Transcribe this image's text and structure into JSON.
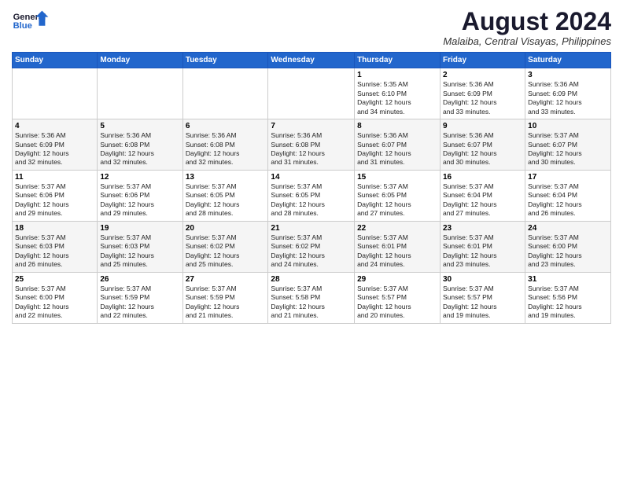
{
  "header": {
    "logo_general": "General",
    "logo_blue": "Blue",
    "month_year": "August 2024",
    "location": "Malaiba, Central Visayas, Philippines"
  },
  "weekdays": [
    "Sunday",
    "Monday",
    "Tuesday",
    "Wednesday",
    "Thursday",
    "Friday",
    "Saturday"
  ],
  "weeks": [
    [
      {
        "day": "",
        "info": ""
      },
      {
        "day": "",
        "info": ""
      },
      {
        "day": "",
        "info": ""
      },
      {
        "day": "",
        "info": ""
      },
      {
        "day": "1",
        "info": "Sunrise: 5:35 AM\nSunset: 6:10 PM\nDaylight: 12 hours\nand 34 minutes."
      },
      {
        "day": "2",
        "info": "Sunrise: 5:36 AM\nSunset: 6:09 PM\nDaylight: 12 hours\nand 33 minutes."
      },
      {
        "day": "3",
        "info": "Sunrise: 5:36 AM\nSunset: 6:09 PM\nDaylight: 12 hours\nand 33 minutes."
      }
    ],
    [
      {
        "day": "4",
        "info": "Sunrise: 5:36 AM\nSunset: 6:09 PM\nDaylight: 12 hours\nand 32 minutes."
      },
      {
        "day": "5",
        "info": "Sunrise: 5:36 AM\nSunset: 6:08 PM\nDaylight: 12 hours\nand 32 minutes."
      },
      {
        "day": "6",
        "info": "Sunrise: 5:36 AM\nSunset: 6:08 PM\nDaylight: 12 hours\nand 32 minutes."
      },
      {
        "day": "7",
        "info": "Sunrise: 5:36 AM\nSunset: 6:08 PM\nDaylight: 12 hours\nand 31 minutes."
      },
      {
        "day": "8",
        "info": "Sunrise: 5:36 AM\nSunset: 6:07 PM\nDaylight: 12 hours\nand 31 minutes."
      },
      {
        "day": "9",
        "info": "Sunrise: 5:36 AM\nSunset: 6:07 PM\nDaylight: 12 hours\nand 30 minutes."
      },
      {
        "day": "10",
        "info": "Sunrise: 5:37 AM\nSunset: 6:07 PM\nDaylight: 12 hours\nand 30 minutes."
      }
    ],
    [
      {
        "day": "11",
        "info": "Sunrise: 5:37 AM\nSunset: 6:06 PM\nDaylight: 12 hours\nand 29 minutes."
      },
      {
        "day": "12",
        "info": "Sunrise: 5:37 AM\nSunset: 6:06 PM\nDaylight: 12 hours\nand 29 minutes."
      },
      {
        "day": "13",
        "info": "Sunrise: 5:37 AM\nSunset: 6:05 PM\nDaylight: 12 hours\nand 28 minutes."
      },
      {
        "day": "14",
        "info": "Sunrise: 5:37 AM\nSunset: 6:05 PM\nDaylight: 12 hours\nand 28 minutes."
      },
      {
        "day": "15",
        "info": "Sunrise: 5:37 AM\nSunset: 6:05 PM\nDaylight: 12 hours\nand 27 minutes."
      },
      {
        "day": "16",
        "info": "Sunrise: 5:37 AM\nSunset: 6:04 PM\nDaylight: 12 hours\nand 27 minutes."
      },
      {
        "day": "17",
        "info": "Sunrise: 5:37 AM\nSunset: 6:04 PM\nDaylight: 12 hours\nand 26 minutes."
      }
    ],
    [
      {
        "day": "18",
        "info": "Sunrise: 5:37 AM\nSunset: 6:03 PM\nDaylight: 12 hours\nand 26 minutes."
      },
      {
        "day": "19",
        "info": "Sunrise: 5:37 AM\nSunset: 6:03 PM\nDaylight: 12 hours\nand 25 minutes."
      },
      {
        "day": "20",
        "info": "Sunrise: 5:37 AM\nSunset: 6:02 PM\nDaylight: 12 hours\nand 25 minutes."
      },
      {
        "day": "21",
        "info": "Sunrise: 5:37 AM\nSunset: 6:02 PM\nDaylight: 12 hours\nand 24 minutes."
      },
      {
        "day": "22",
        "info": "Sunrise: 5:37 AM\nSunset: 6:01 PM\nDaylight: 12 hours\nand 24 minutes."
      },
      {
        "day": "23",
        "info": "Sunrise: 5:37 AM\nSunset: 6:01 PM\nDaylight: 12 hours\nand 23 minutes."
      },
      {
        "day": "24",
        "info": "Sunrise: 5:37 AM\nSunset: 6:00 PM\nDaylight: 12 hours\nand 23 minutes."
      }
    ],
    [
      {
        "day": "25",
        "info": "Sunrise: 5:37 AM\nSunset: 6:00 PM\nDaylight: 12 hours\nand 22 minutes."
      },
      {
        "day": "26",
        "info": "Sunrise: 5:37 AM\nSunset: 5:59 PM\nDaylight: 12 hours\nand 22 minutes."
      },
      {
        "day": "27",
        "info": "Sunrise: 5:37 AM\nSunset: 5:59 PM\nDaylight: 12 hours\nand 21 minutes."
      },
      {
        "day": "28",
        "info": "Sunrise: 5:37 AM\nSunset: 5:58 PM\nDaylight: 12 hours\nand 21 minutes."
      },
      {
        "day": "29",
        "info": "Sunrise: 5:37 AM\nSunset: 5:57 PM\nDaylight: 12 hours\nand 20 minutes."
      },
      {
        "day": "30",
        "info": "Sunrise: 5:37 AM\nSunset: 5:57 PM\nDaylight: 12 hours\nand 19 minutes."
      },
      {
        "day": "31",
        "info": "Sunrise: 5:37 AM\nSunset: 5:56 PM\nDaylight: 12 hours\nand 19 minutes."
      }
    ]
  ]
}
